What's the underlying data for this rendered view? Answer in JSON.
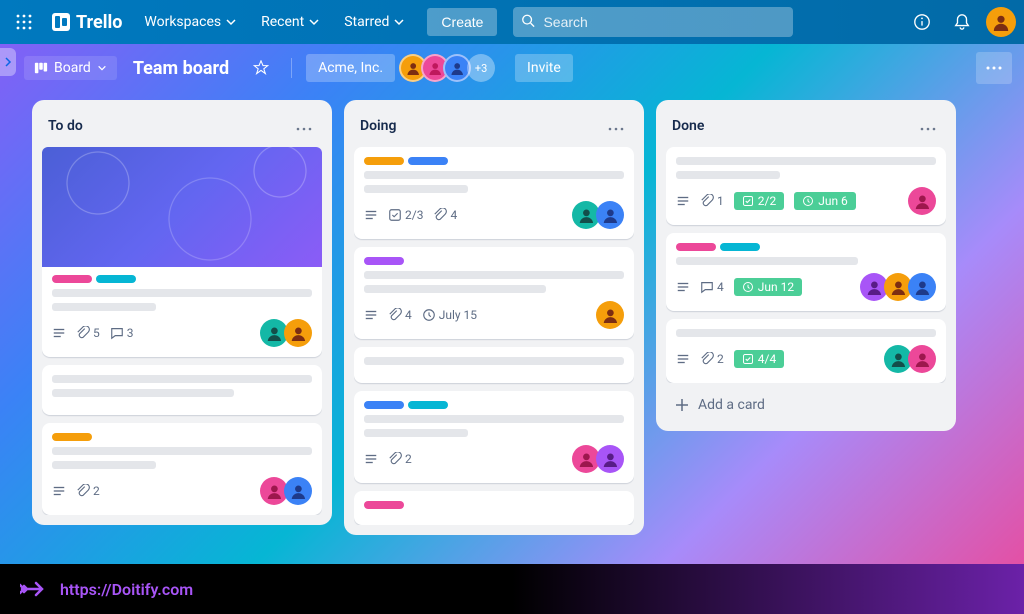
{
  "topbar": {
    "logo": "Trello",
    "nav": {
      "workspaces": "Workspaces",
      "recent": "Recent",
      "starred": "Starred"
    },
    "create": "Create",
    "search_placeholder": "Search"
  },
  "subbar": {
    "board_view": "Board",
    "board_title": "Team board",
    "workspace": "Acme, Inc.",
    "extra_members": "+3",
    "invite": "Invite"
  },
  "lists": [
    {
      "title": "To do",
      "cards": [
        {
          "cover": true,
          "labels": [
            "pink",
            "cyan"
          ],
          "badges": {
            "attachments": "5",
            "comments": "3"
          },
          "members": [
            "teal",
            "yellow"
          ]
        },
        {
          "labels": [
            "yellow"
          ],
          "badges": {
            "attachments": "2"
          },
          "members": [
            "pink",
            "blue"
          ]
        }
      ]
    },
    {
      "title": "Doing",
      "cards": [
        {
          "labels": [
            "yellow",
            "blue"
          ],
          "badges": {
            "checklist": "2/3",
            "attachments": "4"
          },
          "members": [
            "teal",
            "blue"
          ]
        },
        {
          "labels": [
            "purple"
          ],
          "badges": {
            "attachments": "4",
            "due": "July 15"
          },
          "members": [
            "yellow"
          ]
        },
        {
          "labels": [
            "blue",
            "cyan"
          ],
          "badges": {
            "attachments": "2"
          },
          "members": [
            "pink",
            "purple"
          ]
        },
        {
          "labels": [
            "pink"
          ],
          "badges": {},
          "members": []
        }
      ]
    },
    {
      "title": "Done",
      "cards": [
        {
          "labels": [],
          "badges": {
            "attachments": "1",
            "checklist_done": "2/2",
            "due_done": "Jun 6"
          },
          "members": [
            "pink"
          ]
        },
        {
          "labels": [
            "pink",
            "cyan"
          ],
          "badges": {
            "comments": "4",
            "due_done": "Jun 12"
          },
          "members": [
            "purple",
            "yellow",
            "blue"
          ]
        },
        {
          "labels": [],
          "badges": {
            "attachments": "2",
            "checklist_done": "4/4"
          },
          "members": [
            "teal",
            "pink"
          ]
        }
      ],
      "add_label": "Add a card"
    }
  ],
  "footer": {
    "url": "https://Doitify.com"
  }
}
